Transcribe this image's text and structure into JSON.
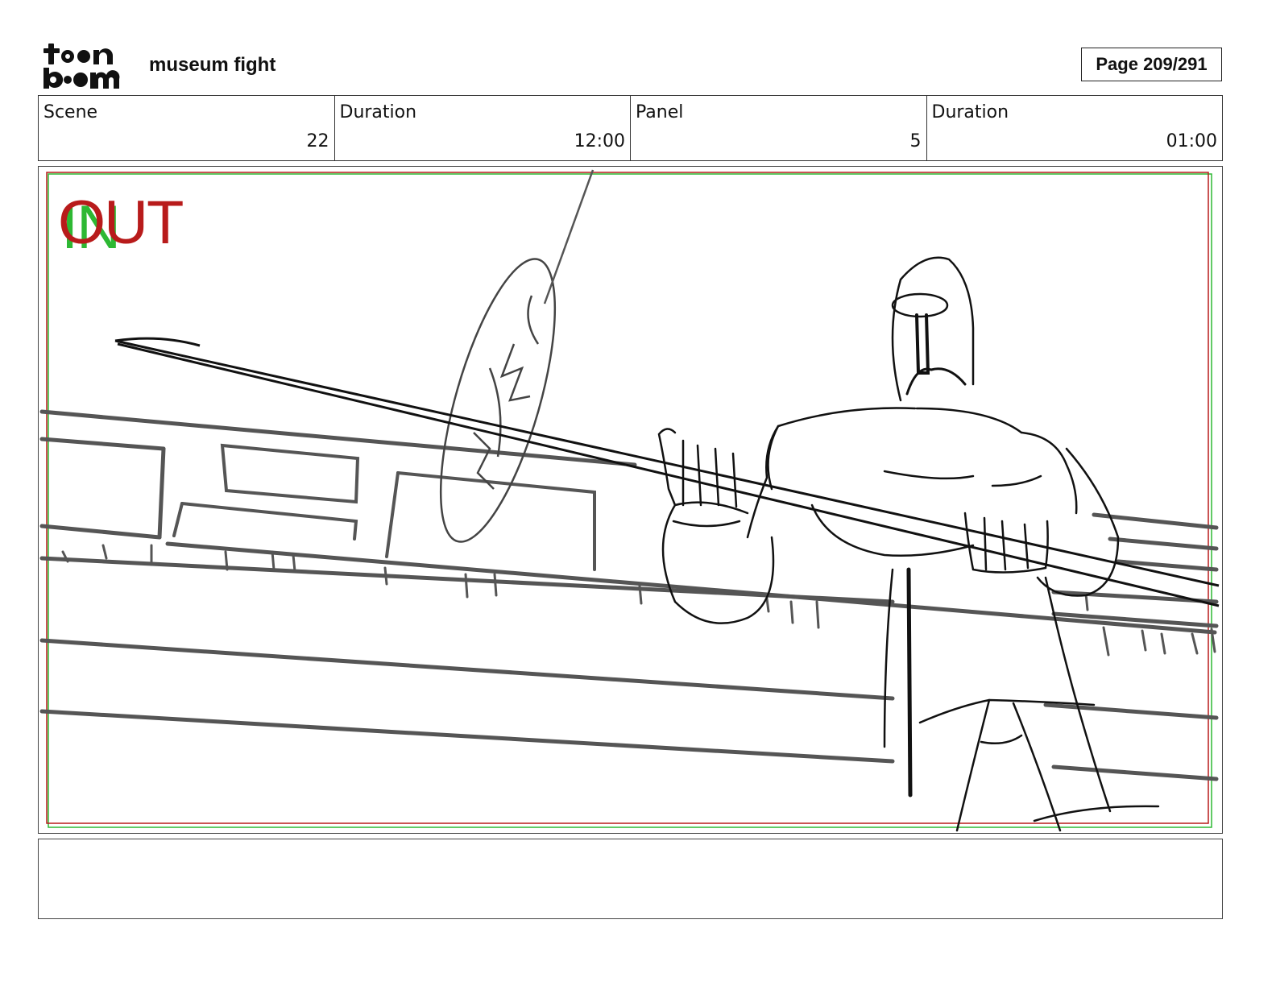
{
  "header": {
    "logo_text": "toon boom",
    "project_title": "museum fight",
    "page_label": "Page 209/291"
  },
  "info": {
    "scene_label": "Scene",
    "scene_value": "22",
    "scene_duration_label": "Duration",
    "scene_duration_value": "12:00",
    "panel_label": "Panel",
    "panel_value": "5",
    "panel_duration_label": "Duration",
    "panel_duration_value": "01:00"
  },
  "panel": {
    "in_marker": "IN",
    "out_marker": "OUT",
    "colors": {
      "in_frame": "#2db833",
      "out_frame": "#b81b1b"
    }
  },
  "notes": {
    "text": ""
  }
}
